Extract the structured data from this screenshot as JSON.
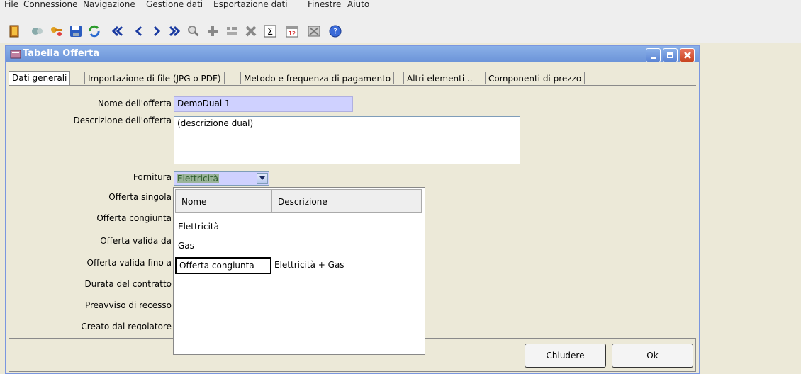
{
  "menu": [
    "File",
    "Connessione",
    "Navigazione",
    "Gestione dati",
    "Esportazione dati",
    "Finestre",
    "Aiuto"
  ],
  "toolbar": {
    "icons": [
      "exit-icon",
      "connect-icon",
      "key-icon",
      "save-icon",
      "refresh-icon",
      "first-record-icon",
      "previous-record-icon",
      "next-record-icon",
      "last-record-icon",
      "search-icon",
      "add-icon",
      "edit-icon",
      "delete-icon",
      "sum-icon",
      "calendar-icon",
      "export-icon",
      "help-icon"
    ]
  },
  "window": {
    "title": "Tabella Offerta"
  },
  "tabs": [
    "Dati generali",
    "Importazione di file (JPG o PDF)",
    "Metodo e frequenza di pagamento",
    "Altri elementi ..",
    "Componenti di prezzo"
  ],
  "form": {
    "nome_label": "Nome dell'offerta",
    "nome_value": "DemoDual 1",
    "descrizione_label": "Descrizione dell'offerta",
    "descrizione_value": "(descrizione dual)",
    "fornitura_label": "Fornitura",
    "fornitura_value": "Elettricità",
    "offerta_singola_label": "Offerta singola",
    "offerta_congiunta_label": "Offerta congiunta",
    "valida_da_label": "Offerta valida da",
    "valida_fino_label": "Offerta valida fino a",
    "durata_label": "Durata del contratto",
    "preavviso_label": "Preavviso di recesso",
    "creato_label": "Creato dal regolatore"
  },
  "dropdown": {
    "columns": [
      "Nome",
      "Descrizione"
    ],
    "rows": [
      {
        "nome": "Elettricità",
        "descrizione": ""
      },
      {
        "nome": "Gas",
        "descrizione": ""
      },
      {
        "nome": "Offerta congiunta",
        "descrizione": "Elettricità + Gas"
      }
    ]
  },
  "buttons": {
    "close": "Chiudere",
    "ok": "Ok"
  },
  "colors": {
    "titlebar": "#7aa3e3",
    "selected_field": "#cfd1ff"
  }
}
